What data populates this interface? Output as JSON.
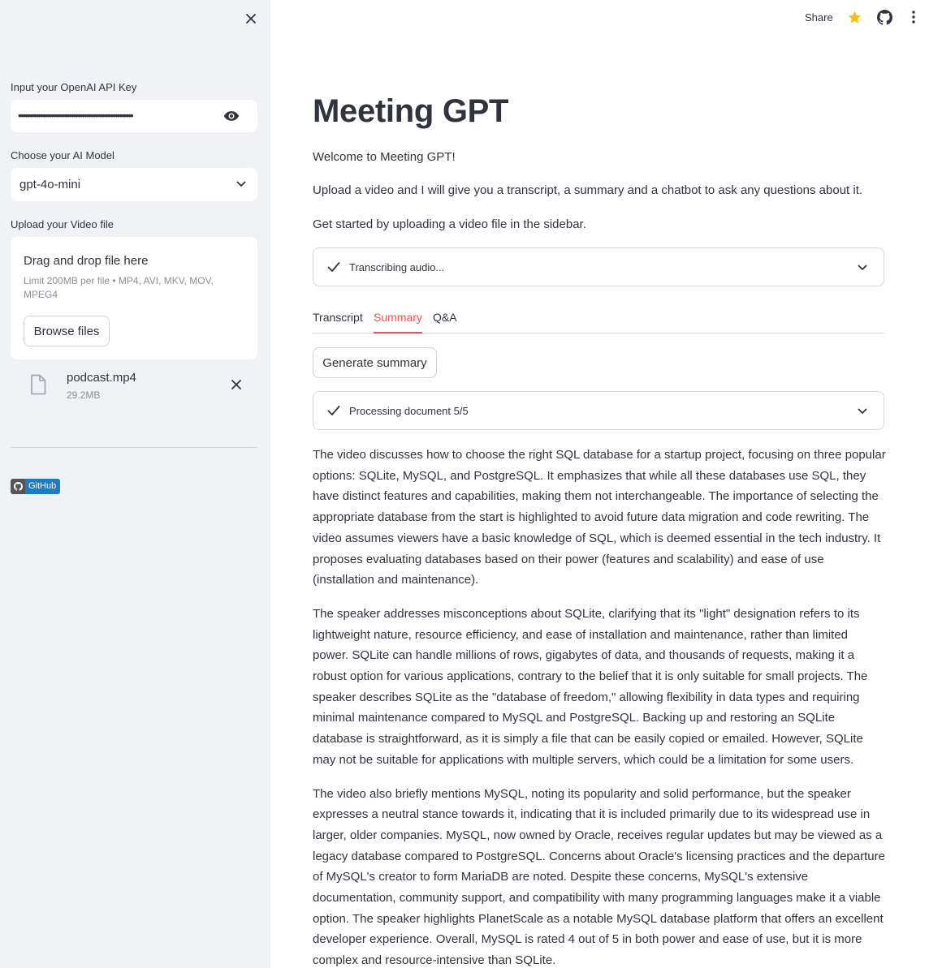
{
  "sidebar": {
    "api_key_label": "Input your OpenAI API Key",
    "api_key_masked": "••••••••••••••••••••••••••••••••••••••••••••••••••••",
    "model_label": "Choose your AI Model",
    "model_value": "gpt-4o-mini",
    "upload_label": "Upload your Video file",
    "dropzone_title": "Drag and drop file here",
    "dropzone_limit": "Limit 200MB per file • MP4, AVI, MKV, MOV, MPEG4",
    "browse_label": "Browse files",
    "file_name": "podcast.mp4",
    "file_size": "29.2MB",
    "github_badge": "GitHub"
  },
  "header": {
    "share_label": "Share"
  },
  "main": {
    "title": "Meeting GPT",
    "welcome": "Welcome to Meeting GPT!",
    "intro": "Upload a video and I will give you a transcript, a summary and a chatbot to ask any questions about it.",
    "get_started": "Get started by uploading a video file in the sidebar.",
    "status_transcribe": "Transcribing audio...",
    "tabs": [
      "Transcript",
      "Summary",
      "Q&A"
    ],
    "generate_label": "Generate summary",
    "status_processing": "Processing document 5/5",
    "summary": [
      "The video discusses how to choose the right SQL database for a startup project, focusing on three popular options: SQLite, MySQL, and PostgreSQL. It emphasizes that while all these databases use SQL, they have distinct features and capabilities, making them not interchangeable. The importance of selecting the appropriate database from the start is highlighted to avoid future data migration and code rewriting. The video assumes viewers have a basic knowledge of SQL, which is deemed essential in the tech industry. It proposes evaluating databases based on their power (features and scalability) and ease of use (installation and maintenance).",
      "The speaker addresses misconceptions about SQLite, clarifying that its \"light\" designation refers to its lightweight nature, resource efficiency, and ease of installation and maintenance, rather than limited power. SQLite can handle millions of rows, gigabytes of data, and thousands of requests, making it a robust option for various applications, contrary to the belief that it is only suitable for small projects. The speaker describes SQLite as the \"database of freedom,\" allowing flexibility in data types and requiring minimal maintenance compared to MySQL and PostgreSQL. Backing up and restoring an SQLite database is straightforward, as it is simply a file that can be easily copied or emailed. However, SQLite may not be suitable for applications with multiple servers, which could be a limitation for some users.",
      "The video also briefly mentions MySQL, noting its popularity and solid performance, but the speaker expresses a neutral stance towards it, indicating that it is included primarily due to its widespread use in larger, older companies. MySQL, now owned by Oracle, receives regular updates but may be viewed as a legacy database compared to PostgreSQL. Concerns about Oracle's licensing practices and the departure of MySQL's creator to form MariaDB are noted. Despite these concerns, MySQL's extensive documentation, community support, and compatibility with many programming languages make it a viable option. The speaker highlights PlanetScale as a notable MySQL database platform that offers an excellent developer experience. Overall, MySQL is rated 4 out of 5 in both power and ease of use, but it is more complex and resource-intensive than SQLite."
    ]
  },
  "colors": {
    "accent": "#ff4b4b",
    "sidebar_bg": "#f0f2f6",
    "text": "#31333f",
    "star": "#f5c211"
  }
}
